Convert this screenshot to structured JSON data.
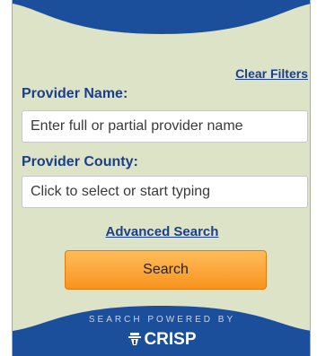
{
  "filters": {
    "clear_label": "Clear Filters"
  },
  "provider_name": {
    "label": "Provider Name:",
    "placeholder": "Enter full or partial provider name"
  },
  "provider_county": {
    "label": "Provider County:",
    "placeholder": "Click to select or start typing"
  },
  "advanced_search_label": "Advanced Search",
  "search_button_label": "Search",
  "footer": {
    "powered_by": "SEARCH POWERED BY",
    "brand": "CRISP",
    "brand_icon": "crisp-logo-icon"
  },
  "colors": {
    "panel_bg": "#dde3c6",
    "accent_blue": "#1b4f9c",
    "link_blue": "#1b3f8a",
    "button_orange": "#f7941e"
  }
}
